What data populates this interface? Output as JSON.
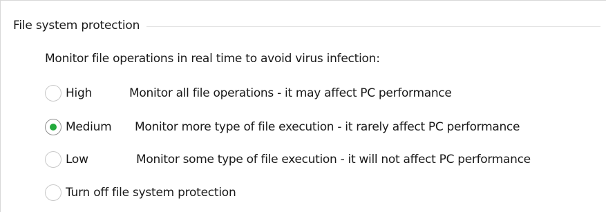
{
  "group": {
    "title": "File system protection"
  },
  "intro_text": "Monitor file operations in real time to avoid virus infection:",
  "options": [
    {
      "label": "High",
      "description": "Monitor all file operations - it may affect PC performance",
      "selected": false
    },
    {
      "label": "Medium",
      "description": "Monitor more type of file execution - it rarely affect PC performance",
      "selected": true
    },
    {
      "label": "Low",
      "description": "Monitor some type of file execution - it will not affect PC performance",
      "selected": false
    },
    {
      "label": "Turn off file system protection",
      "description": "",
      "selected": false
    }
  ],
  "colors": {
    "radio_selected": "#22aa3c",
    "text": "#1a1a1a"
  }
}
